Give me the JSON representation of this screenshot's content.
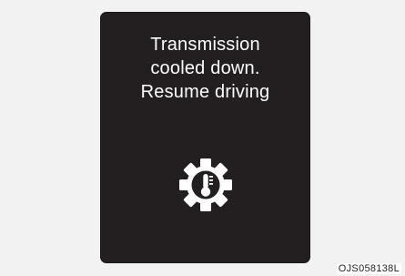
{
  "display": {
    "message_lines": [
      "Transmission",
      "cooled down.",
      "Resume driving"
    ],
    "icon": "transmission-temperature-gear-icon",
    "background_color": "#231f20",
    "text_color": "#ffffff"
  },
  "caption": "OJS058138L"
}
